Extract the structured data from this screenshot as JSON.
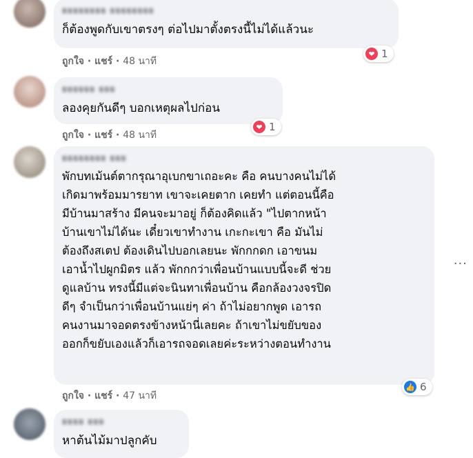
{
  "comments": [
    {
      "author": "ยยยยยยยย ยยยยยยยย",
      "text": "ก็ต้องพูดกับเขาตรงๆ ต่อไปมาตั้งตรงนี้ไม่ได้แล้วนะ",
      "like_label": "ถูกใจ",
      "share_label": "แชร์",
      "time": "48 นาที",
      "reaction_icon": "love-icon",
      "reaction_count": "1"
    },
    {
      "author": "ยยยยยย ยยย",
      "text": "ลองคุยกันดีๆ บอกเหตุผลไปก่อน",
      "like_label": "ถูกใจ",
      "share_label": "แชร์",
      "time": "48 นาที",
      "reaction_icon": "love-icon",
      "reaction_count": "1"
    },
    {
      "author": "ยยยยยยยย ยยย",
      "text": "พักบทเม้นต์ตากรุณาอุเบกขาเถอะคะ คือ คนบางคนไม่ได้\nเกิดมาพร้อมมารยาท เขาจะเคยตาก เคยทำ แต่ตอนนี้คือ\nมีบ้านมาสร้าง มีคนจะมาอยู่ ก็ต้องคิดแล้ว \"ไปตากหน้า\nบ้านเขาไม่ได้นะ เดี๋ยวเขาทำงาน เกะกะเขา คือ มันไม่\nต้องถึงสเตป ต้องเดินไปบอกเลยนะ พักกกดก เอาขนม\nเอาน้ำไปผูกมิตร แล้ว พักกกว่าเพื่อนบ้านแบบนี้จะดี ช่วย\nดูแลบ้าน ทรงนี้มีแต่จะนินทาเพื่อนบ้าน คือกล้องวงจรปิด\nดีๆ จำเป็นกว่าเพื่อนบ้านแย่ๆ ค่า ถ้าไม่อยากพูด เอารถ\nคนงานมาจอดตรงข้างหน้านี่เลยคะ ถ้าเขาไม่ขยับของ\nออกก็ขยับเองแล้วก็เอารถจอดเลยค่ะระหว่างตอนทำงาน",
      "like_label": "ถูกใจ",
      "share_label": "แชร์",
      "time": "47 นาที",
      "reaction_icon": "like-icon",
      "reaction_count": "6"
    },
    {
      "author": "ยยยย ยยย",
      "text": "หาต้นไม้มาปลูกคับ"
    }
  ],
  "separator": " · ",
  "more_icon": "more-options-icon"
}
